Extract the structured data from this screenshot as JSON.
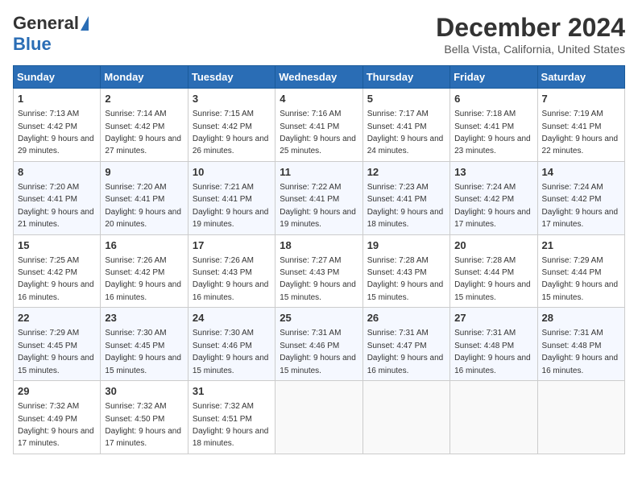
{
  "header": {
    "logo_general": "General",
    "logo_blue": "Blue",
    "month_title": "December 2024",
    "location": "Bella Vista, California, United States"
  },
  "calendar": {
    "days_of_week": [
      "Sunday",
      "Monday",
      "Tuesday",
      "Wednesday",
      "Thursday",
      "Friday",
      "Saturday"
    ],
    "weeks": [
      [
        {
          "day": "1",
          "sunrise": "7:13 AM",
          "sunset": "4:42 PM",
          "daylight": "9 hours and 29 minutes."
        },
        {
          "day": "2",
          "sunrise": "7:14 AM",
          "sunset": "4:42 PM",
          "daylight": "9 hours and 27 minutes."
        },
        {
          "day": "3",
          "sunrise": "7:15 AM",
          "sunset": "4:42 PM",
          "daylight": "9 hours and 26 minutes."
        },
        {
          "day": "4",
          "sunrise": "7:16 AM",
          "sunset": "4:41 PM",
          "daylight": "9 hours and 25 minutes."
        },
        {
          "day": "5",
          "sunrise": "7:17 AM",
          "sunset": "4:41 PM",
          "daylight": "9 hours and 24 minutes."
        },
        {
          "day": "6",
          "sunrise": "7:18 AM",
          "sunset": "4:41 PM",
          "daylight": "9 hours and 23 minutes."
        },
        {
          "day": "7",
          "sunrise": "7:19 AM",
          "sunset": "4:41 PM",
          "daylight": "9 hours and 22 minutes."
        }
      ],
      [
        {
          "day": "8",
          "sunrise": "7:20 AM",
          "sunset": "4:41 PM",
          "daylight": "9 hours and 21 minutes."
        },
        {
          "day": "9",
          "sunrise": "7:20 AM",
          "sunset": "4:41 PM",
          "daylight": "9 hours and 20 minutes."
        },
        {
          "day": "10",
          "sunrise": "7:21 AM",
          "sunset": "4:41 PM",
          "daylight": "9 hours and 19 minutes."
        },
        {
          "day": "11",
          "sunrise": "7:22 AM",
          "sunset": "4:41 PM",
          "daylight": "9 hours and 19 minutes."
        },
        {
          "day": "12",
          "sunrise": "7:23 AM",
          "sunset": "4:41 PM",
          "daylight": "9 hours and 18 minutes."
        },
        {
          "day": "13",
          "sunrise": "7:24 AM",
          "sunset": "4:42 PM",
          "daylight": "9 hours and 17 minutes."
        },
        {
          "day": "14",
          "sunrise": "7:24 AM",
          "sunset": "4:42 PM",
          "daylight": "9 hours and 17 minutes."
        }
      ],
      [
        {
          "day": "15",
          "sunrise": "7:25 AM",
          "sunset": "4:42 PM",
          "daylight": "9 hours and 16 minutes."
        },
        {
          "day": "16",
          "sunrise": "7:26 AM",
          "sunset": "4:42 PM",
          "daylight": "9 hours and 16 minutes."
        },
        {
          "day": "17",
          "sunrise": "7:26 AM",
          "sunset": "4:43 PM",
          "daylight": "9 hours and 16 minutes."
        },
        {
          "day": "18",
          "sunrise": "7:27 AM",
          "sunset": "4:43 PM",
          "daylight": "9 hours and 15 minutes."
        },
        {
          "day": "19",
          "sunrise": "7:28 AM",
          "sunset": "4:43 PM",
          "daylight": "9 hours and 15 minutes."
        },
        {
          "day": "20",
          "sunrise": "7:28 AM",
          "sunset": "4:44 PM",
          "daylight": "9 hours and 15 minutes."
        },
        {
          "day": "21",
          "sunrise": "7:29 AM",
          "sunset": "4:44 PM",
          "daylight": "9 hours and 15 minutes."
        }
      ],
      [
        {
          "day": "22",
          "sunrise": "7:29 AM",
          "sunset": "4:45 PM",
          "daylight": "9 hours and 15 minutes."
        },
        {
          "day": "23",
          "sunrise": "7:30 AM",
          "sunset": "4:45 PM",
          "daylight": "9 hours and 15 minutes."
        },
        {
          "day": "24",
          "sunrise": "7:30 AM",
          "sunset": "4:46 PM",
          "daylight": "9 hours and 15 minutes."
        },
        {
          "day": "25",
          "sunrise": "7:31 AM",
          "sunset": "4:46 PM",
          "daylight": "9 hours and 15 minutes."
        },
        {
          "day": "26",
          "sunrise": "7:31 AM",
          "sunset": "4:47 PM",
          "daylight": "9 hours and 16 minutes."
        },
        {
          "day": "27",
          "sunrise": "7:31 AM",
          "sunset": "4:48 PM",
          "daylight": "9 hours and 16 minutes."
        },
        {
          "day": "28",
          "sunrise": "7:31 AM",
          "sunset": "4:48 PM",
          "daylight": "9 hours and 16 minutes."
        }
      ],
      [
        {
          "day": "29",
          "sunrise": "7:32 AM",
          "sunset": "4:49 PM",
          "daylight": "9 hours and 17 minutes."
        },
        {
          "day": "30",
          "sunrise": "7:32 AM",
          "sunset": "4:50 PM",
          "daylight": "9 hours and 17 minutes."
        },
        {
          "day": "31",
          "sunrise": "7:32 AM",
          "sunset": "4:51 PM",
          "daylight": "9 hours and 18 minutes."
        },
        null,
        null,
        null,
        null
      ]
    ],
    "labels": {
      "sunrise": "Sunrise:",
      "sunset": "Sunset:",
      "daylight": "Daylight:"
    }
  }
}
